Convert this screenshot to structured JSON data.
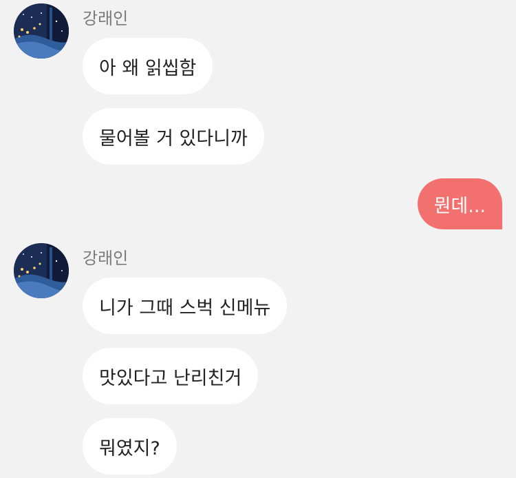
{
  "icons": {
    "avatar": "profile-photo-icon"
  },
  "colors": {
    "background": "#f2f2f2",
    "incoming_bubble": "#ffffff",
    "outgoing_bubble": "#f2706d",
    "sender_name": "#7a7a7a"
  },
  "chat": {
    "groups": [
      {
        "sender": "강래인",
        "messages": [
          "아 왜 읽씹함",
          "물어볼 거 있다니까"
        ]
      },
      {
        "sender": "강래인",
        "messages": [
          "니가 그때 스벅 신메뉴",
          "맛있다고 난리친거",
          "뭐였지?"
        ]
      }
    ],
    "outgoing": [
      "뭔데..."
    ]
  }
}
